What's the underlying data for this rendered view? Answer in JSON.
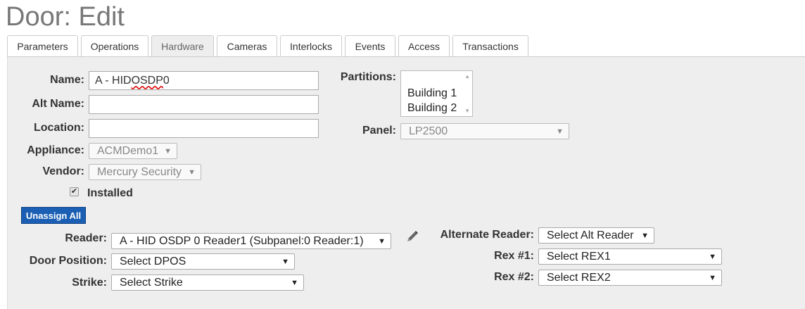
{
  "page": {
    "title": "Door: Edit"
  },
  "tabs": [
    {
      "label": "Parameters",
      "active": false
    },
    {
      "label": "Operations",
      "active": false
    },
    {
      "label": "Hardware",
      "active": true
    },
    {
      "label": "Cameras",
      "active": false
    },
    {
      "label": "Interlocks",
      "active": false
    },
    {
      "label": "Events",
      "active": false
    },
    {
      "label": "Access",
      "active": false
    },
    {
      "label": "Transactions",
      "active": false
    }
  ],
  "form": {
    "name": {
      "label": "Name:",
      "value_prefix": "A - HID ",
      "value_misspelled": "OSDP",
      "value_suffix": " 0"
    },
    "alt_name": {
      "label": "Alt Name:",
      "value": ""
    },
    "location": {
      "label": "Location:",
      "value": ""
    },
    "appliance": {
      "label": "Appliance:",
      "value": "ACMDemo1"
    },
    "vendor": {
      "label": "Vendor:",
      "value": "Mercury Security"
    },
    "installed": {
      "label": "Installed",
      "checked": true
    },
    "partitions": {
      "label": "Partitions:",
      "options": [
        "Building 1",
        "Building 2"
      ]
    },
    "panel": {
      "label": "Panel:",
      "value": "LP2500"
    }
  },
  "hardware": {
    "unassign_label": "Unassign All",
    "reader": {
      "label": "Reader:",
      "value": "A - HID OSDP 0 Reader1 (Subpanel:0 Reader:1)"
    },
    "door_position": {
      "label": "Door Position:",
      "value": "Select DPOS"
    },
    "strike": {
      "label": "Strike:",
      "value": "Select Strike"
    },
    "alternate_reader": {
      "label": "Alternate Reader:",
      "value": "Select Alt Reader"
    },
    "rex1": {
      "label": "Rex #1:",
      "value": "Select REX1"
    },
    "rex2": {
      "label": "Rex #2:",
      "value": "Select REX2"
    }
  },
  "icons": {
    "caret": "caret-down-icon",
    "edit": "pencil-icon",
    "check": "checkmark-icon"
  }
}
